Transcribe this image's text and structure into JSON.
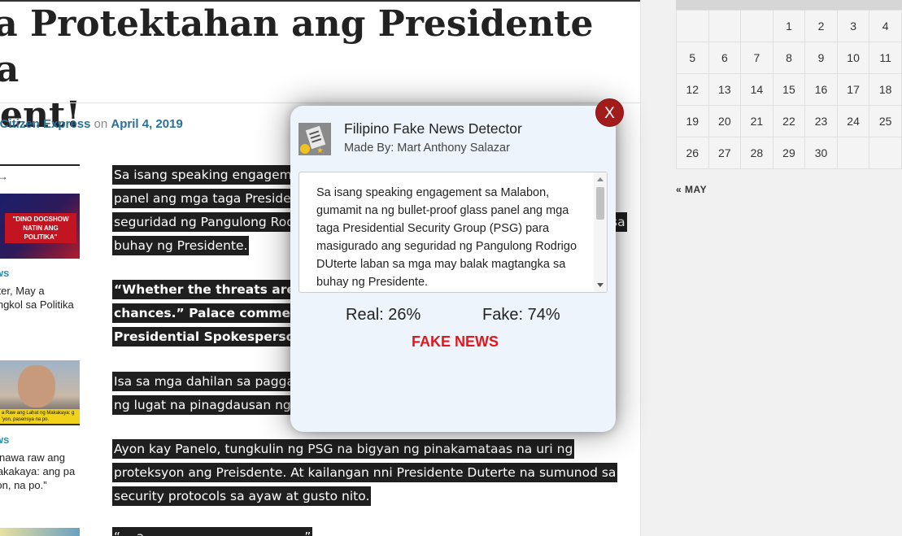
{
  "article": {
    "title_line1": "ra Protektahan ang Presidente sa",
    "title_line2": "ent!",
    "byline_prefix": "y ",
    "byline_author": "Citizen Express",
    "byline_on": " on ",
    "byline_date": "April 4, 2019",
    "paragraphs": [
      "Sa isang speaking engagement sa Malabon, gumamit na ng bullet-proof glass panel ang mga taga Presidential Security Group (PSG) para masigurado ang seguridad ng Pangulong Rodrigo DUterte laban sa mga may balak magtangka sa buhay ng Presidente.",
      "“Whether the threats are real or not, the President cannot take any chances.” Palace commends the PSG for doing their job, pahayag ni Presidential Spokesperson Savador Panelo.",
      "Isa sa mga dahilan sa paggamit ng bullet-proof glass panel ay ang “open area” ng lugat na pinagdausan ng event.",
      "Ayon kay Panelo, tungkulin ng PSG na bigyan ng pinakamataas na uri ng proteksyon ang Preisdente. At kailangan nni Presidente Duterte na sumunod sa security protocols sa ayaw at gusto nito.",
      "“... a ... ... ... ... ... ... ... ... ... ...”"
    ]
  },
  "left_sidebar": {
    "next_label": "T →",
    "thumb1_caption": "\"DINO DOGSHOW NATIN ANG POLITIKA\"",
    "cat1": "ws",
    "excerpt1": "orter, May a tungkol sa Politika sa",
    "thumb2_caption": "a Raw ang Lahat ng Makakaya: g 'yon, pasensya na po.",
    "cat2": "ws",
    "excerpt2": "Ginawa raw ang Makakaya: ang pa ‘yon, na po.”"
  },
  "calendar": {
    "rows": [
      [
        "",
        "",
        "",
        "1",
        "2",
        "3",
        "4"
      ],
      [
        "5",
        "6",
        "7",
        "8",
        "9",
        "10",
        "11"
      ],
      [
        "12",
        "13",
        "14",
        "15",
        "16",
        "17",
        "18"
      ],
      [
        "19",
        "20",
        "21",
        "22",
        "23",
        "24",
        "25"
      ],
      [
        "26",
        "27",
        "28",
        "29",
        "30",
        "",
        ""
      ]
    ],
    "prev_link": "« MAY"
  },
  "popup": {
    "close_label": "X",
    "title": "Filipino Fake News Detector",
    "subtitle": "Made By: Mart Anthony Salazar",
    "analyzed_text": "Sa isang speaking engagement sa Malabon, gumamit na ng bullet-proof glass panel ang mga taga Presidential Security Group (PSG) para masigurado ang seguridad ng Pangulong Rodrigo DUterte laban sa mga may balak magtangka sa buhay ng Presidente.",
    "real_score": "Real: 26%",
    "fake_score": "Fake: 74%",
    "verdict": "FAKE NEWS",
    "verdict_color": "#e8141b",
    "close_color": "#a31c1c"
  }
}
